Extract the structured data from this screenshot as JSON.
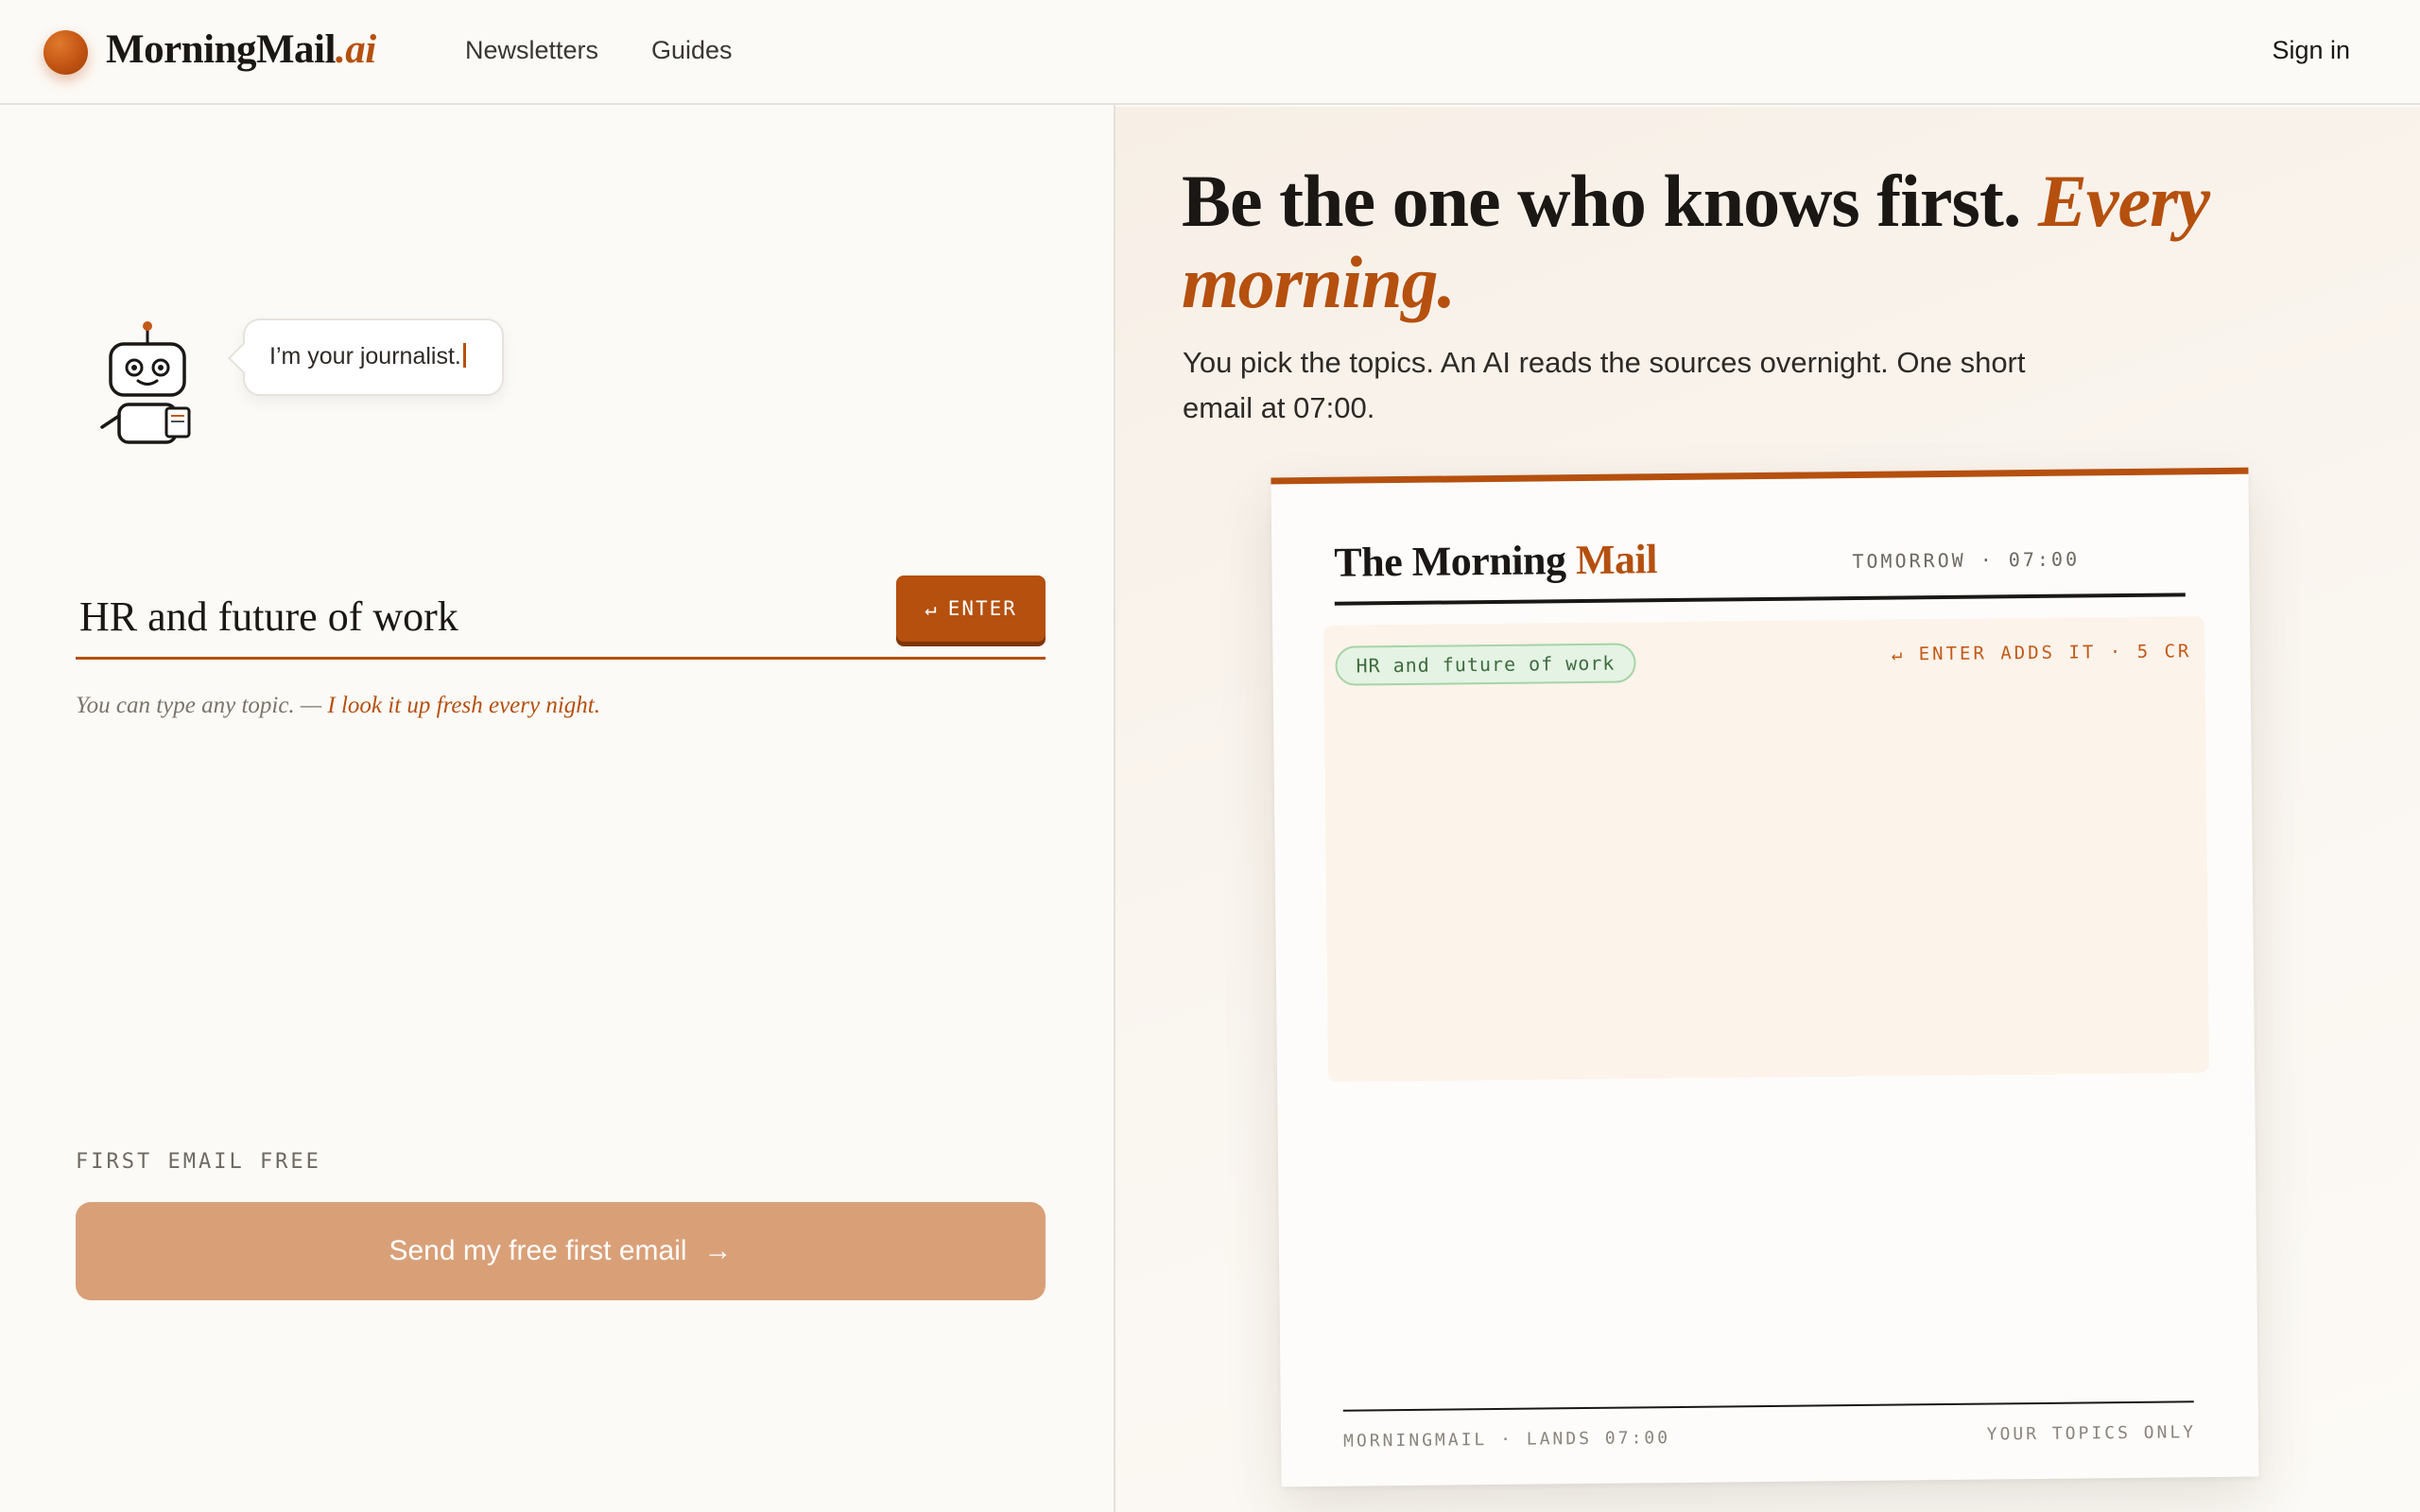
{
  "header": {
    "brand": "MorningMail",
    "brand_suffix": ".ai",
    "nav": [
      "Newsletters",
      "Guides"
    ],
    "sign_in": "Sign in"
  },
  "left": {
    "bubble": "I’m your journalist.",
    "topic_value": "HR and future of work",
    "enter_label": "ENTER",
    "enter_icon": "return-arrow-icon",
    "hint_prefix": "You can type any topic. — ",
    "hint_accent": "I look it up fresh every night.",
    "free_label": "FIRST EMAIL FREE",
    "send_label": "Send my free first email",
    "send_icon": "arrow-right-icon"
  },
  "hero": {
    "title_part1": "Be the one who knows first. ",
    "title_accent": "Every morning.",
    "subtitle": "You pick the topics. An AI reads the sources overnight. One short email at 07:00."
  },
  "card": {
    "title_part1": "The Morning ",
    "title_accent": "Mail",
    "time": "TOMORROW · 07:00",
    "chip": "HR and future of work",
    "enter_hint": "↵ ENTER ADDS IT · 5 CR",
    "footer_left": "MORNINGMAIL · LANDS 07:00",
    "footer_right": "YOUR TOPICS ONLY"
  },
  "colors": {
    "accent": "#b5500f",
    "send_button": "#d9a078",
    "background": "#fcfaf6",
    "chip_bg": "#e4f3e4"
  }
}
